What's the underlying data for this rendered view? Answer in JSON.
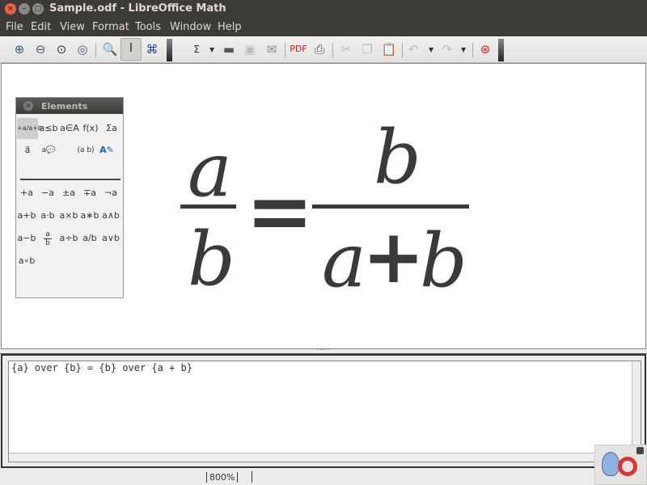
{
  "window": {
    "title": "Sample.odf - LibreOffice Math"
  },
  "menu": [
    "File",
    "Edit",
    "View",
    "Format",
    "Tools",
    "Window",
    "Help"
  ],
  "toolbar": {
    "items": [
      "zoom-in",
      "zoom-out",
      "zoom-100",
      "zoom-page",
      "show-all",
      "formula-cursor",
      "symbols",
      "elements-formula",
      "open",
      "save",
      "email",
      "export-pdf",
      "print",
      "cut",
      "copy",
      "paste",
      "undo",
      "redo",
      "help"
    ]
  },
  "formula": {
    "lhs_num": "a",
    "lhs_den": "b",
    "equals": "=",
    "rhs_num": "b",
    "rhs_den_a": "a",
    "rhs_den_plus": "+",
    "rhs_den_b": "b"
  },
  "elements": {
    "title": "Elements",
    "categories": [
      "+a/a+b",
      "a≤b",
      "a∈A",
      "f(x)",
      "Σa",
      "a⃗",
      "a💬",
      "(a b)",
      "A✎"
    ],
    "items": [
      "+a",
      "−a",
      "±a",
      "∓a",
      "¬a",
      "a+b",
      "a·b",
      "a×b",
      "a∗b",
      "a∧b",
      "a−b",
      "a/b frac",
      "a÷b",
      "a/b",
      "a∨b",
      "a∘b"
    ],
    "frac_num": "a",
    "frac_den": "b"
  },
  "command": {
    "text": "{a} over {b} = {b} over {a + b}"
  },
  "status": {
    "zoom": "800%"
  }
}
